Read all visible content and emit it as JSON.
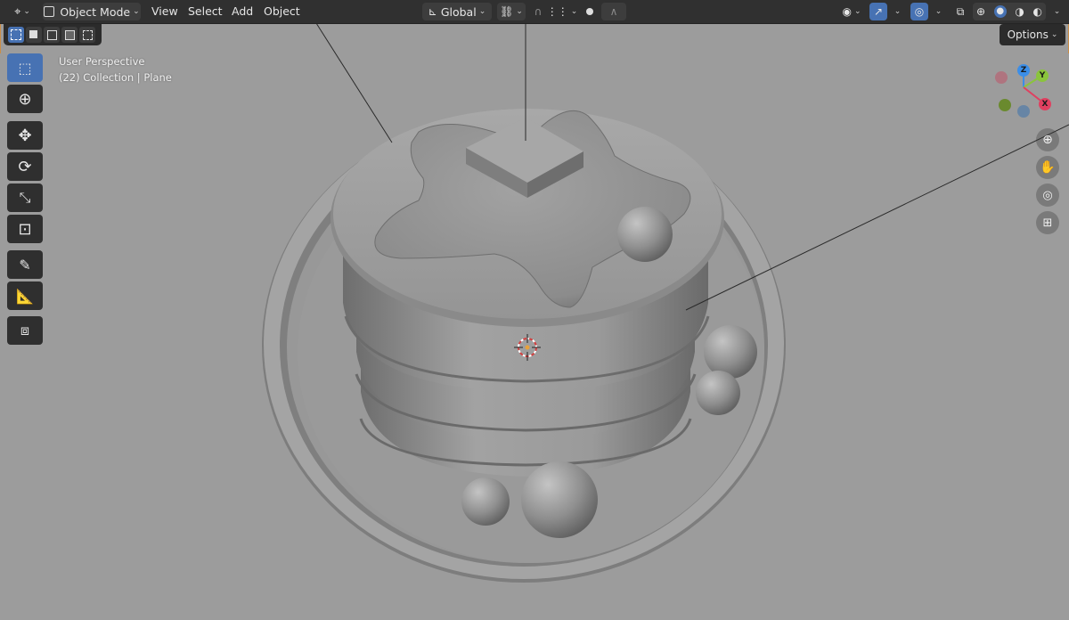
{
  "header": {
    "editor_type_icon": "axes-icon",
    "mode_label": "Object Mode",
    "menus": [
      "View",
      "Select",
      "Add",
      "Object"
    ],
    "transform_orientation": "Global"
  },
  "toolbar_row2": {
    "options_label": "Options"
  },
  "tools": [
    {
      "name": "select-box-tool",
      "icon": "cursor-icon",
      "active": true
    },
    {
      "name": "cursor-tool",
      "icon": "crosshair-icon",
      "active": false
    },
    {
      "name": "move-tool",
      "icon": "move-icon",
      "active": false
    },
    {
      "name": "rotate-tool",
      "icon": "rotate-icon",
      "active": false
    },
    {
      "name": "scale-tool",
      "icon": "scale-icon",
      "active": false
    },
    {
      "name": "transform-tool",
      "icon": "transform-icon",
      "active": false
    },
    {
      "name": "annotate-tool",
      "icon": "pencil-icon",
      "active": false
    },
    {
      "name": "measure-tool",
      "icon": "ruler-icon",
      "active": false
    },
    {
      "name": "add-cube-tool",
      "icon": "add-cube-icon",
      "active": false
    }
  ],
  "overlay": {
    "view_name": "User Perspective",
    "collection_info": "(22) Collection | Plane"
  },
  "gizmo": {
    "x_label": "X",
    "y_label": "Y",
    "z_label": "Z",
    "x_color": "#e04060",
    "y_color": "#8ac43c",
    "z_color": "#3b8ee8"
  },
  "colors": {
    "accent": "#4772b3",
    "header_bg": "#303030",
    "viewport_bg": "#9c9c9c"
  }
}
